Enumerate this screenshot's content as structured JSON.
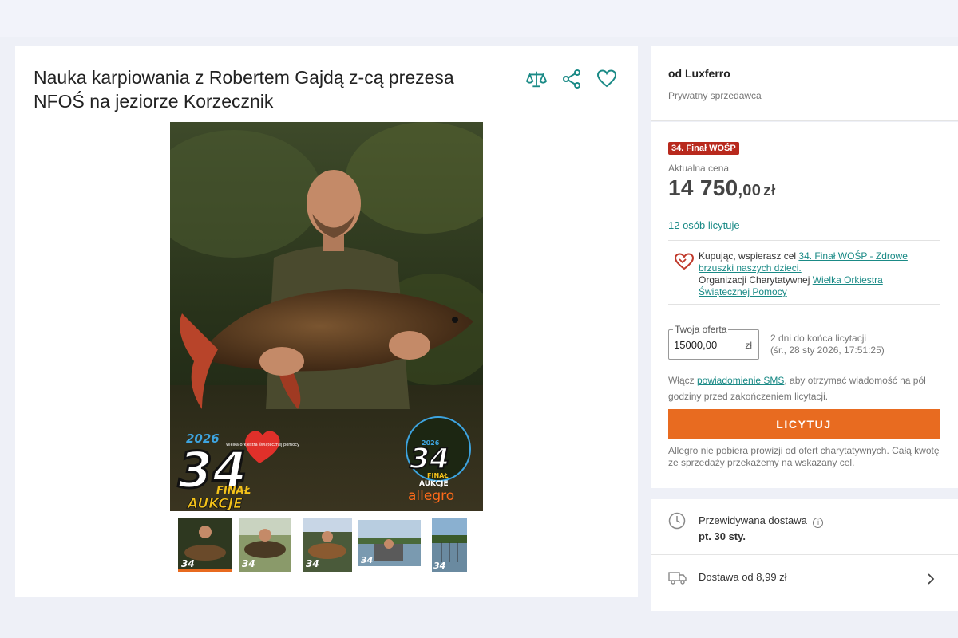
{
  "listing": {
    "title": "Nauka karpiowania z Robertem Gajdą z-cą prezesa NFOŚ na jeziorze Korzecznik",
    "photo_badge_year": "2026",
    "photo_badge_number": "34",
    "photo_badge_final": "FINAŁ",
    "photo_badge_aukcje": "AUKCJE",
    "photo_badge_heart_text": "wielka orkiestra świątecznej pomocy",
    "photo_logo_year": "2026",
    "photo_logo_number": "34",
    "photo_logo_final": "FINAŁ",
    "photo_logo_aukcje": "AUKCJE",
    "photo_logo_brand": "allegro"
  },
  "seller": {
    "name": "od Luxferro",
    "type": "Prywatny sprzedawca"
  },
  "offer": {
    "badge": "34. Finał WOŚP",
    "price_label": "Aktualna cena",
    "price_int": "14 750",
    "price_dec": ",00",
    "price_cur": "zł",
    "bidders_link": "12 osób licytuje",
    "charity_text1": "Kupując, wspierasz cel ",
    "charity_link1": "34. Finał WOŚP - Zdrowe brzuszki naszych dzieci.",
    "charity_text2": "Organizacji Charytatywnej ",
    "charity_link2": "Wielka Orkiestra Świątecznej Pomocy",
    "your_offer_label": "Twoja oferta",
    "your_offer_value": "15000,00",
    "your_offer_currency": "zł",
    "time_left": "2 dni do końca licytacji",
    "end_date": "(śr., 28 sty 2026, 17:51:25)",
    "sms_text1": "Włącz ",
    "sms_link": "powiadomienie SMS",
    "sms_text2": ", aby otrzymać wiadomość na pół godziny przed zakończeniem licytacji.",
    "bid_button": "LICYTUJ",
    "note": "Allegro nie pobiera prowizji od ofert charytatywnych. Całą kwotę ze sprzedaży przekażemy na wskazany cel."
  },
  "delivery": {
    "expected_label": "Przewidywana dostawa",
    "expected_date": "pt. 30 sty.",
    "cost_label": "Dostawa od 8,99 zł"
  },
  "colors": {
    "accent": "#1a8a86",
    "button": "#e86b20",
    "badge": "#b8291d"
  }
}
